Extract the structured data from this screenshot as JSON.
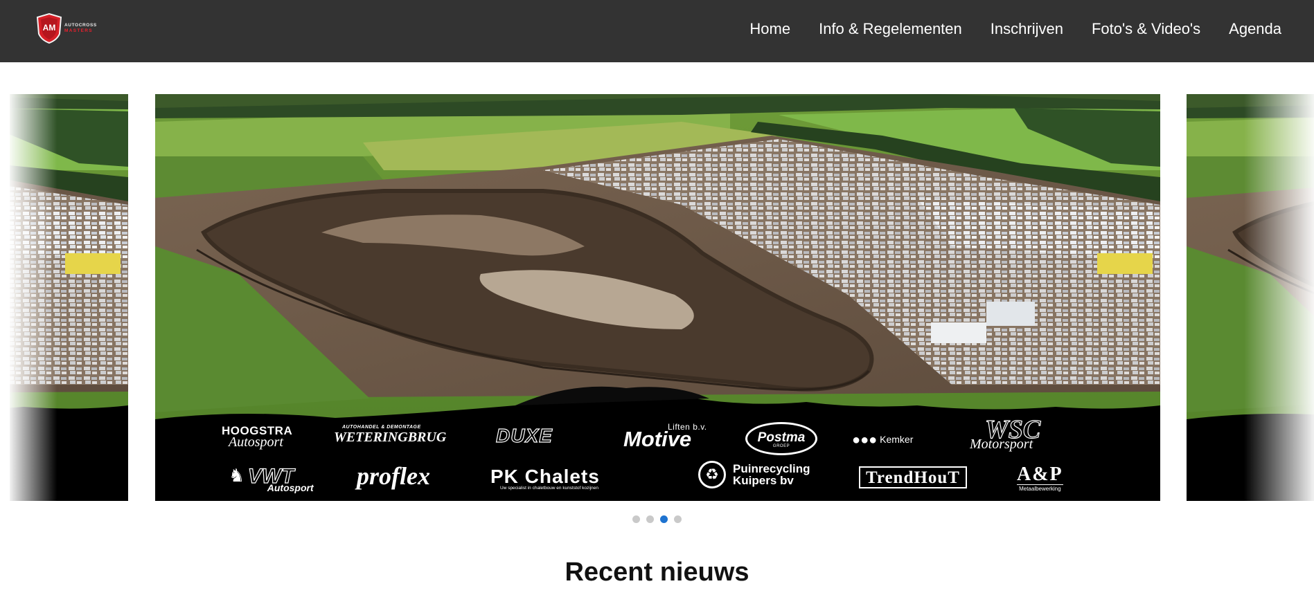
{
  "header": {
    "logo": {
      "line1": "AUTOCROSS",
      "line2": "MASTERS",
      "badge": "AM"
    },
    "nav": [
      {
        "label": "Home"
      },
      {
        "label": "Info & Regelementen"
      },
      {
        "label": "Inschrijven"
      },
      {
        "label": "Foto's & Video's"
      },
      {
        "label": "Agenda"
      }
    ]
  },
  "carousel": {
    "active_index": 2,
    "slide_count": 4,
    "sponsors": {
      "hoogstra": {
        "top": "HOOGSTRA",
        "bottom": "Autosport"
      },
      "weteringbrug": {
        "top": "AUTOHANDEL & DEMONTAGE",
        "bottom": "WETERINGBRUG"
      },
      "duxe": "DUXE",
      "motive": {
        "big": "Motive",
        "small": "Liften b.v."
      },
      "postma": {
        "name": "Postma",
        "sub": "GROEP"
      },
      "kemker": "Kemker",
      "wsc": {
        "top": "WSC",
        "bottom": "Motorsport"
      },
      "vwt": {
        "top": "VWT",
        "bottom": "Autosport"
      },
      "proflex": "proflex",
      "pkchalets": {
        "name": "PK Chalets",
        "sub": "Uw specialist in chaletbouw en kunststof kozijnen"
      },
      "kuipers": {
        "line1": "Puinrecycling",
        "line2": "Kuipers bv"
      },
      "trendhout": "TrendHouT",
      "ap": {
        "name": "A&P",
        "sub": "Metaalbewerking"
      }
    }
  },
  "section": {
    "title": "Recent nieuws"
  },
  "colors": {
    "header_bg": "#333333",
    "dot_active": "#1e73d0",
    "dot_inactive": "#c9c9c9",
    "brand_red": "#e8202d"
  }
}
